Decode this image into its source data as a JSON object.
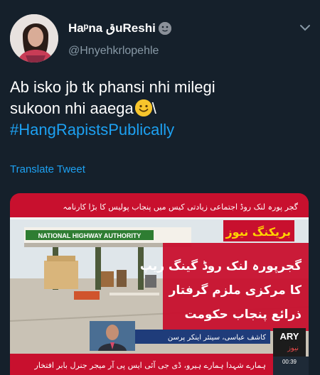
{
  "header": {
    "display_name": "Haᵖna قuReshi",
    "handle": "@Hnyehkrlopehle"
  },
  "tweet": {
    "line1": "Ab isko jb tk phansi nhi milegi",
    "line2_text": "sukoon nhi aaega",
    "line2_suffix": "\\",
    "hashtag": "#HangRapistsPublically",
    "translate": "Translate Tweet"
  },
  "media": {
    "top_strip": "گجر پورہ لنک روڈ اجتماعی زیادتی کیس میں پنجاب پولیس کا بڑا کارنامہ",
    "sign": "NATIONAL HIGHWAY AUTHORITY",
    "breaking": "بریکنگ نیوز",
    "headline1": "گجرپورہ لنک روڈ گینگ ریپ",
    "headline2": "کا مرکزی ملزم گرفتار",
    "headline3": "ذرائع پنجاب حکومت",
    "reporter": "کاشف عباسی، سینئر اینکر پرسن",
    "ticker": "ہمارے شہدا ہمارے ہیرو، ڈی جی آئی ایس پی آر میجر جنرل بابر افتخار",
    "channel": "ARY",
    "channel_sub": "نیوز",
    "time": "00:39",
    "colors": {
      "red": "#c8102e",
      "sky": "#dfe6ea",
      "road": "#c9c2b5"
    }
  }
}
